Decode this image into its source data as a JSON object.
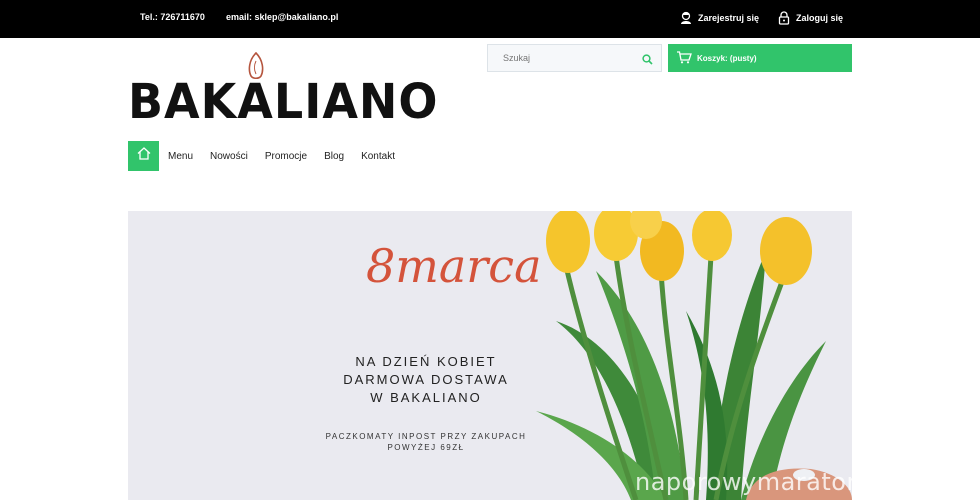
{
  "topbar": {
    "phone": "Tel.: 726711670",
    "email": "email: sklep@bakaliano.pl",
    "register": "Zarejestruj się",
    "login": "Zaloguj się"
  },
  "logo": {
    "text": "BAKALIANO"
  },
  "search": {
    "placeholder": "Szukaj"
  },
  "cart": {
    "label": "Koszyk: (pusty)"
  },
  "nav": {
    "items": [
      "Menu",
      "Nowości",
      "Promocje",
      "Blog",
      "Kontakt"
    ]
  },
  "banner": {
    "date": "8marca",
    "line1": "NA DZIEŃ KOBIET",
    "line2": "DARMOWA DOSTAWA",
    "line3": "W BAKALIANO",
    "sub1": "PACZKOMATY INPOST PRZY ZAKUPACH",
    "sub2": "POWYŻEJ 69ZŁ"
  },
  "watermark": "naporowymaraton.pl",
  "colors": {
    "accent": "#31c46b",
    "topbar": "#000000",
    "date": "#d4533b"
  }
}
